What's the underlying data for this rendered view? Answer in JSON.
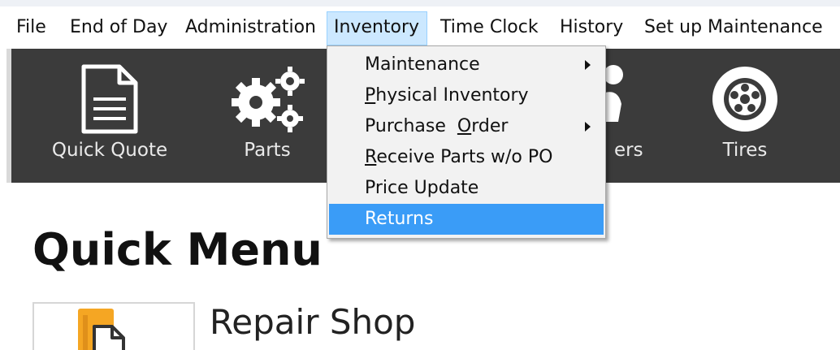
{
  "menubar": {
    "items": [
      {
        "label": "File"
      },
      {
        "label": "End of Day"
      },
      {
        "label": "Administration"
      },
      {
        "label": "Inventory"
      },
      {
        "label": "Time Clock"
      },
      {
        "label": "History"
      },
      {
        "label": "Set up Maintenance"
      }
    ],
    "active": "Inventory"
  },
  "toolbar": {
    "tools": [
      {
        "label": "Quick Quote",
        "icon": "document-icon"
      },
      {
        "label": "Parts",
        "icon": "gears-icon"
      },
      {
        "label": "ers",
        "icon": "person-icon"
      },
      {
        "label": "Tires",
        "icon": "tire-icon"
      }
    ]
  },
  "inventory_menu": {
    "items": [
      {
        "pre": "",
        "mnemonic": "",
        "post": "Maintenance",
        "submenu": true
      },
      {
        "pre": "",
        "mnemonic": "P",
        "post": "hysical Inventory",
        "submenu": false
      },
      {
        "pre": "Purchase  ",
        "mnemonic": "O",
        "post": "rder",
        "submenu": true
      },
      {
        "pre": "",
        "mnemonic": "R",
        "post": "eceive Parts w/o PO",
        "submenu": false
      },
      {
        "pre": "",
        "mnemonic": "",
        "post": "Price Update",
        "submenu": false
      },
      {
        "pre": "",
        "mnemonic": "",
        "post": "Returns",
        "submenu": false
      }
    ],
    "highlighted": "Returns"
  },
  "quick_menu": {
    "title": "Quick Menu",
    "cards": [
      {
        "label": "Repair Shop",
        "icon": "folder-document-icon"
      }
    ]
  },
  "colors": {
    "toolbar_bg": "#3b3b3b",
    "highlight": "#3a9cf7",
    "menu_active_bg": "#cce8ff",
    "card_icon": "#f5a623"
  }
}
